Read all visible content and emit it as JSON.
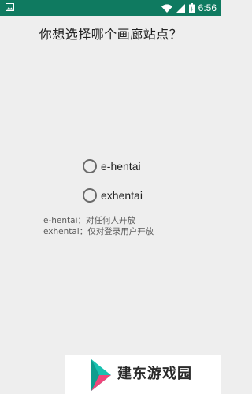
{
  "status_bar": {
    "time": "6:56",
    "icons": [
      "gallery-icon",
      "wifi-icon",
      "signal-icon",
      "battery-icon"
    ],
    "background": "#0f7a60"
  },
  "dialog": {
    "question": "你想选择哪个画廊站点？",
    "options": [
      {
        "label": "e-hentai",
        "selected": false
      },
      {
        "label": "exhentai",
        "selected": false
      }
    ],
    "descriptions": [
      "e-hentai：对任何人开放",
      "exhentai：仅对登录用户开放"
    ]
  },
  "watermark": {
    "text": "建东游戏园",
    "colors": {
      "teal": "#18c1b0",
      "pink": "#f0457a"
    }
  }
}
